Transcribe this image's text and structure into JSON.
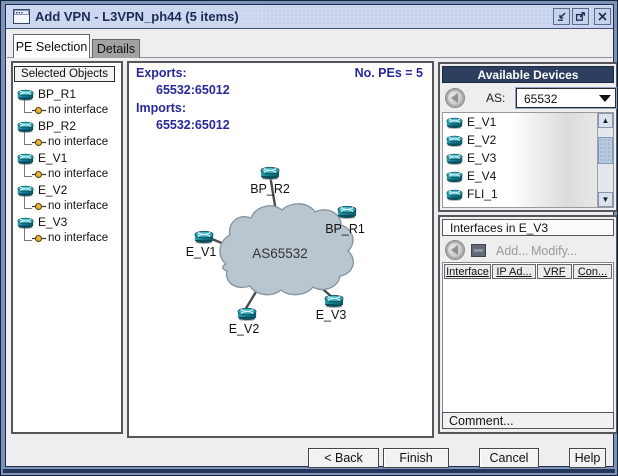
{
  "window": {
    "title": "Add VPN - L3VPN_ph44 (5 items)"
  },
  "tabs": {
    "pe_selection": "PE Selection",
    "details": "Details"
  },
  "selected_objects": {
    "header": "Selected Objects",
    "items": [
      {
        "name": "BP_R1",
        "child": "no interface"
      },
      {
        "name": "BP_R2",
        "child": "no interface"
      },
      {
        "name": "E_V1",
        "child": "no interface"
      },
      {
        "name": "E_V2",
        "child": "no interface"
      },
      {
        "name": "E_V3",
        "child": "no interface"
      }
    ]
  },
  "center": {
    "exports_label": "Exports:",
    "exports_value": "65532:65012",
    "imports_label": "Imports:",
    "imports_value": "65532:65012",
    "pe_count": "No. PEs = 5"
  },
  "diagram": {
    "cloud_label": "AS65532",
    "nodes": [
      {
        "label": "BP_R2"
      },
      {
        "label": "BP_R1"
      },
      {
        "label": "E_V1"
      },
      {
        "label": "E_V2"
      },
      {
        "label": "E_V3"
      }
    ]
  },
  "available_devices": {
    "header": "Available Devices",
    "as_label": "AS:",
    "as_value": "65532",
    "devices": [
      "E_V1",
      "E_V2",
      "E_V3",
      "E_V4",
      "FLI_1"
    ]
  },
  "interfaces_panel": {
    "header": "Interfaces in E_V3",
    "add_label": "Add...",
    "modify_label": "Modify...",
    "columns": [
      "Interface",
      "IP Ad...",
      "VRF",
      "Con..."
    ]
  },
  "comment_label": "Comment...",
  "footer": {
    "back": "< Back",
    "finish": "Finish",
    "cancel": "Cancel",
    "help": "Help"
  },
  "colors": {
    "header_navy": "#2e3e5e",
    "accent_blue": "#28289a",
    "frame_blue": "#7d94b8",
    "cloud_fill": "#b9c6cf",
    "router_teal": "#1c8496"
  }
}
